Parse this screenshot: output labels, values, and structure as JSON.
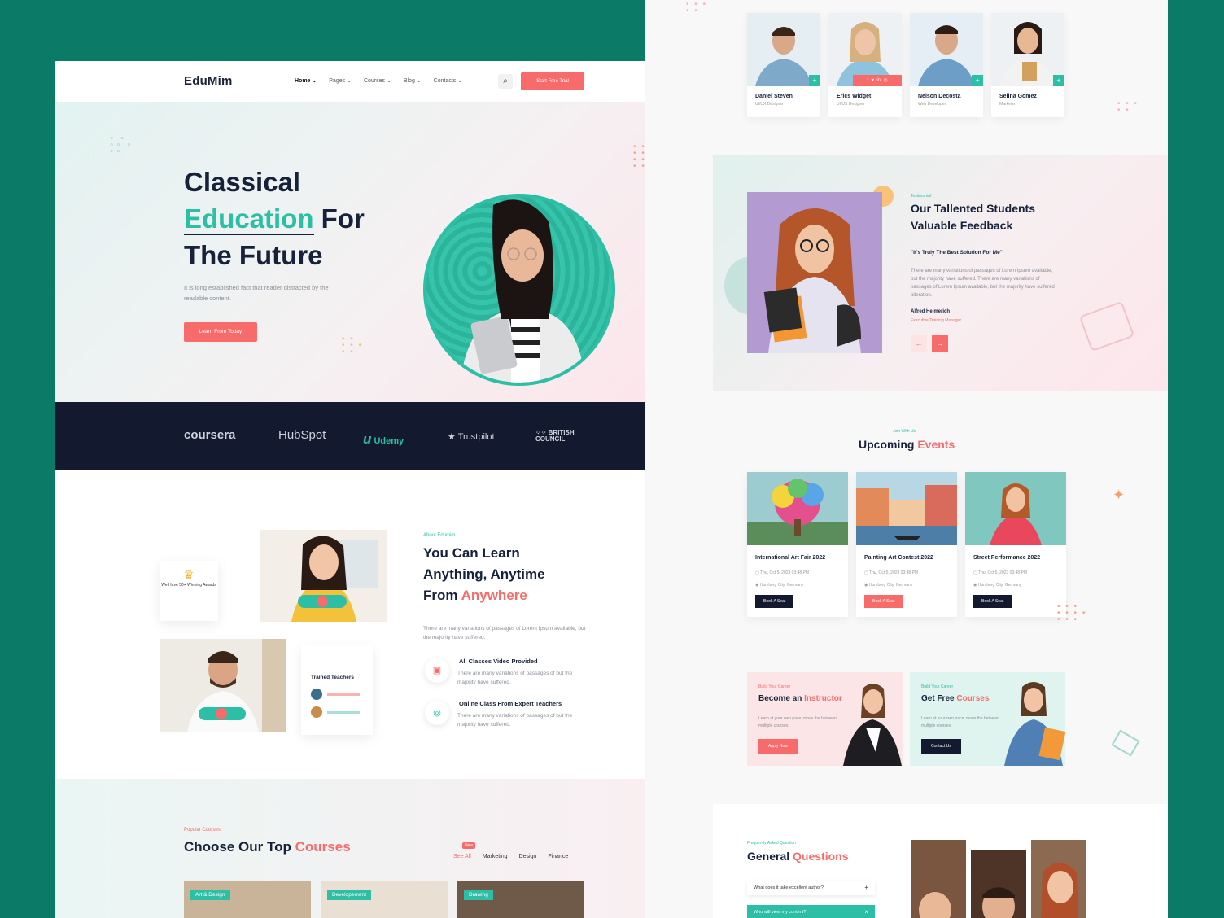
{
  "site": {
    "logo": "EduMim",
    "nav": [
      "Home ⌄",
      "Pages ⌄",
      "Courses ⌄",
      "Blog ⌄",
      "Contacts ⌄"
    ],
    "cta": "Start Free Trial"
  },
  "hero": {
    "line1": "Classical",
    "line2_accent": "Education",
    "line2_rest": " For",
    "line3": "The Future",
    "subtitle": "It is long established fact that reader distracted by the readable content.",
    "button": "Learn From Today"
  },
  "brands": [
    "coursera",
    "HubSpot",
    "Udemy",
    "Trustpilot",
    "BRITISH COUNCIL"
  ],
  "about": {
    "label": "About Edumim",
    "title_line1": "You Can Learn",
    "title_line2": "Anything, Anytime",
    "title_line3_a": "From ",
    "title_line3_b": "Anywhere",
    "text": "There are many variations of passages of Lorem Ipsum available, but the majority have suffered.",
    "award": "We Have 50+ Winning Awards",
    "trained": "Trained Teachers",
    "features": [
      {
        "title": "All Classes Video Provided",
        "text": "There are many variations of passages of but the majority have suffered."
      },
      {
        "title": "Online Class From Expert Teachers",
        "text": "There are many variations of passages of but the majority have suffered."
      }
    ]
  },
  "courses": {
    "label": "Popular Courses",
    "title_a": "Choose Our Top ",
    "title_b": "Courses",
    "new_tag": "New",
    "tabs": [
      "See All",
      "Marketing",
      "Design",
      "Finance"
    ],
    "cards": [
      "Art & Design",
      "Developement",
      "Drawing"
    ]
  },
  "team": [
    {
      "name": "Daniel Steven",
      "role": "UI/UX Designer"
    },
    {
      "name": "Erics Widget",
      "role": "UI/UX Designer"
    },
    {
      "name": "Nelson Decosta",
      "role": "Web Developer"
    },
    {
      "name": "Selina Gomez",
      "role": "Marketer"
    }
  ],
  "testimonial": {
    "label": "Testimonial",
    "title_line1": "Our Tallented Students",
    "title_line2": "Valuable Feedback",
    "quote": "\"It's Truly The Best Solution For Me\"",
    "text": "There are many variations of passages of Lorem Ipsum available, but the majority have suffered. There are many variations of passages of Lorem Ipsum available, but the majority have suffered alteration.",
    "author": "Alfred Helmerich",
    "author_role": "Executive Training Manager"
  },
  "events": {
    "label": "Join With Us",
    "title_a": "Upcoming ",
    "title_b": "Events",
    "items": [
      {
        "title": "International Art Fair 2022",
        "date": "Thu, Oct 5, 2023 03:48 PM",
        "place": "Humberg City, Germany",
        "button": "Book A Seat"
      },
      {
        "title": "Painting Art Contest 2022",
        "date": "Thu, Oct 5, 2023 03:48 PM",
        "place": "Humberg City, Germany",
        "button": "Book A Seat"
      },
      {
        "title": "Street Performance 2022",
        "date": "Thu, Oct 5, 2023 03:48 PM",
        "place": "Humberg City, Germany",
        "button": "Book A Seat"
      }
    ]
  },
  "career": [
    {
      "label": "Build Your Career",
      "title_a": "Become an ",
      "title_b": "Instructor",
      "text": "Learn at your own pace, move the between multiple courses.",
      "button": "Apply Now"
    },
    {
      "label": "Build Your Career",
      "title_a": "Get Free ",
      "title_b": "Courses",
      "text": "Learn at your own pace, move the between multiple courses.",
      "button": "Contact Us"
    }
  ],
  "faq": {
    "label": "Frequently Asked Question",
    "title_a": "General ",
    "title_b": "Questions",
    "items": [
      {
        "q": "What does it take excellent author?",
        "sym": "+"
      },
      {
        "q": "Who will view my content?",
        "sym": "×"
      }
    ]
  },
  "colors": {
    "accent": "#2cbfa5",
    "coral": "#f76b6b",
    "navy": "#13192f",
    "frame": "#0b7a66"
  }
}
